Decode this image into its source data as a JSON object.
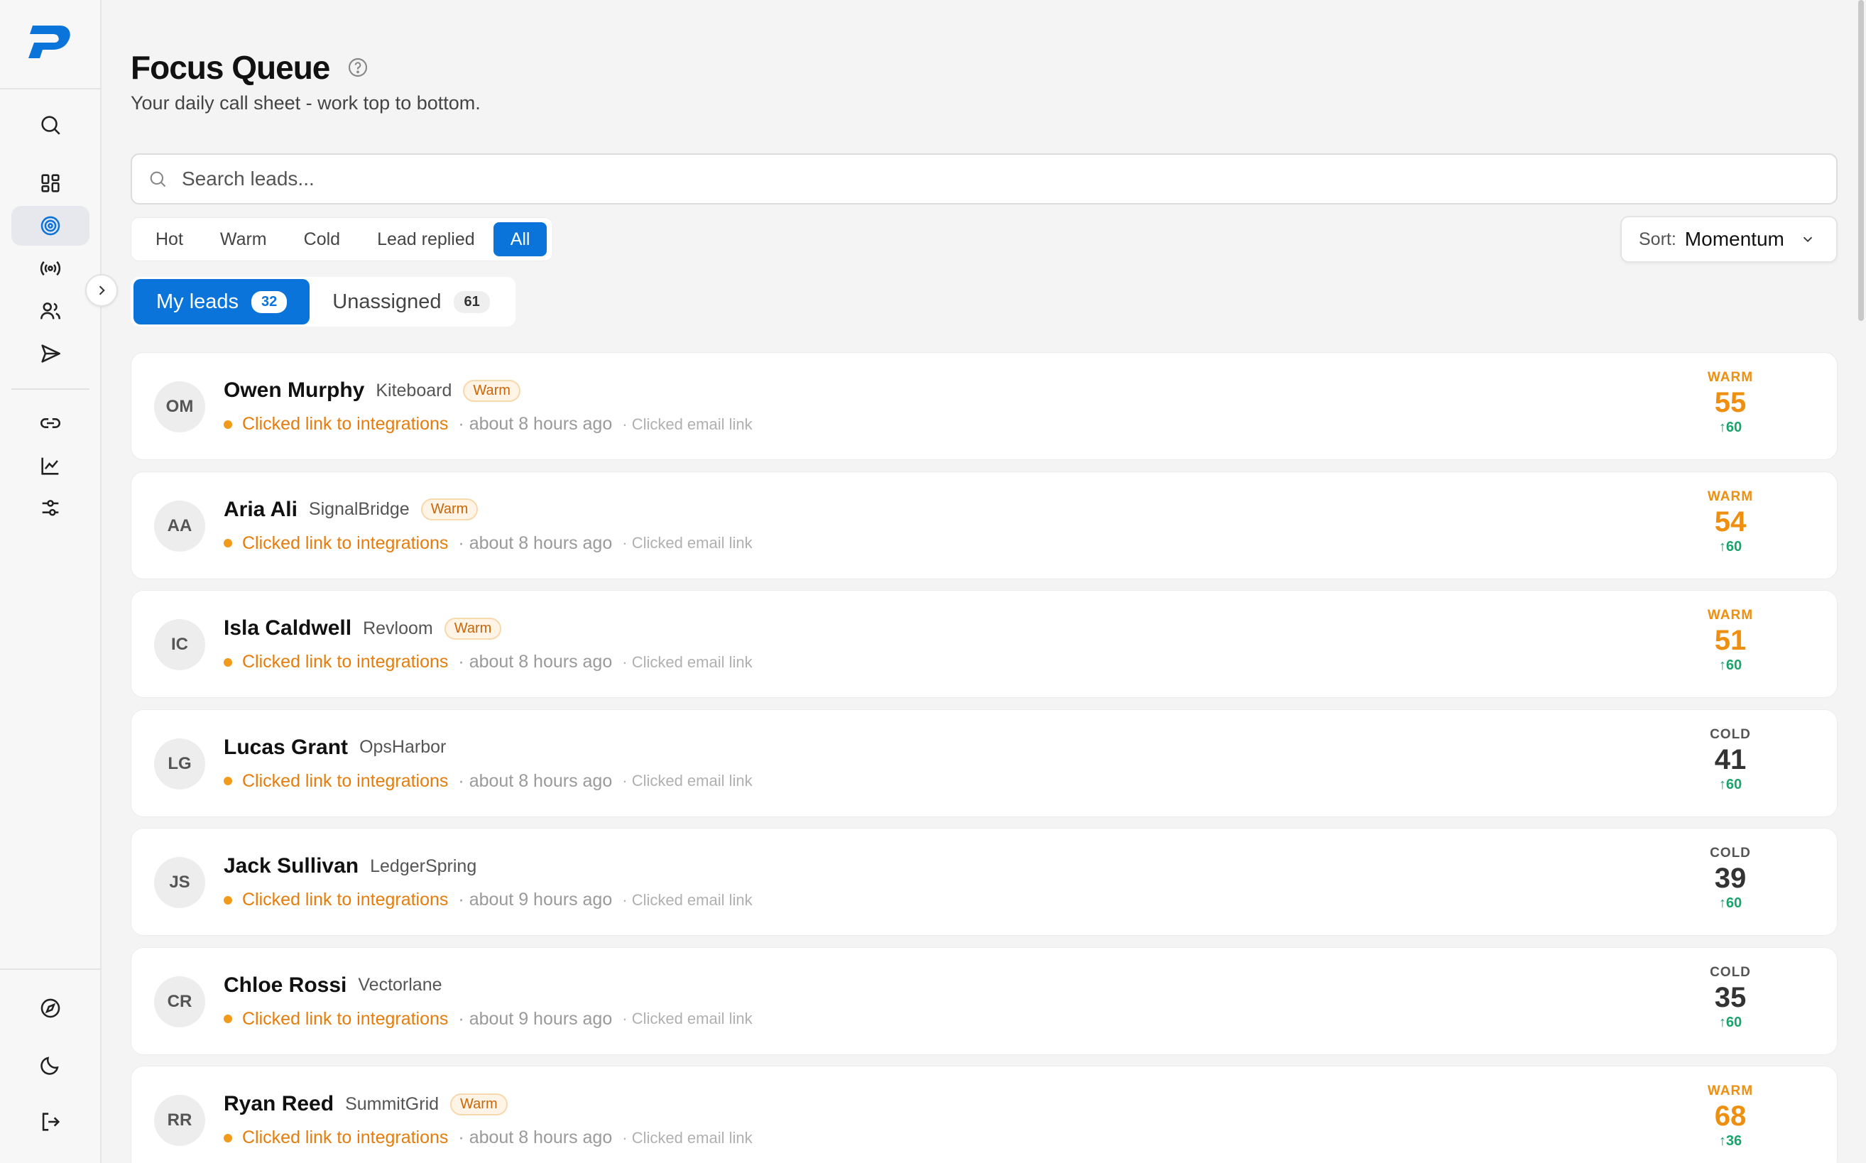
{
  "brand": {
    "logo_icon": "brand-p-logo",
    "accent": "#0a74da"
  },
  "sidebar": {
    "items": [
      {
        "name": "search",
        "icon": "search-icon"
      },
      {
        "name": "dashboard",
        "icon": "dashboard-grid-icon"
      },
      {
        "name": "focus-queue",
        "icon": "target-icon",
        "active": true
      },
      {
        "name": "broadcast",
        "icon": "broadcast-icon"
      },
      {
        "name": "contacts",
        "icon": "users-icon"
      },
      {
        "name": "send",
        "icon": "send-icon"
      },
      {
        "name": "links",
        "icon": "link-icon"
      },
      {
        "name": "analytics",
        "icon": "chart-line-icon"
      },
      {
        "name": "filters",
        "icon": "sliders-icon"
      }
    ],
    "bottom": [
      {
        "name": "explore",
        "icon": "compass-icon"
      },
      {
        "name": "theme",
        "icon": "moon-icon"
      },
      {
        "name": "logout",
        "icon": "logout-icon"
      }
    ]
  },
  "header": {
    "title": "Focus Queue",
    "subtitle": "Your daily call sheet - work top to bottom."
  },
  "search": {
    "placeholder": "Search leads..."
  },
  "filters": {
    "options": [
      "Hot",
      "Warm",
      "Cold",
      "Lead replied",
      "All"
    ],
    "selected": "All"
  },
  "sort": {
    "label": "Sort:",
    "value": "Momentum"
  },
  "tabs": [
    {
      "label": "My leads",
      "count": "32",
      "active": true
    },
    {
      "label": "Unassigned",
      "count": "61",
      "active": false
    }
  ],
  "leads": [
    {
      "initials": "OM",
      "name": "Owen Murphy",
      "company": "Kiteboard",
      "badge": "Warm",
      "activity": "Clicked link to integrations",
      "time": "· about 8 hours ago",
      "source": "· Clicked email link",
      "temp": "WARM",
      "score": "55",
      "delta": "↑60",
      "tone": "warm"
    },
    {
      "initials": "AA",
      "name": "Aria Ali",
      "company": "SignalBridge",
      "badge": "Warm",
      "activity": "Clicked link to integrations",
      "time": "· about 8 hours ago",
      "source": "· Clicked email link",
      "temp": "WARM",
      "score": "54",
      "delta": "↑60",
      "tone": "warm"
    },
    {
      "initials": "IC",
      "name": "Isla Caldwell",
      "company": "Revloom",
      "badge": "Warm",
      "activity": "Clicked link to integrations",
      "time": "· about 8 hours ago",
      "source": "· Clicked email link",
      "temp": "WARM",
      "score": "51",
      "delta": "↑60",
      "tone": "warm"
    },
    {
      "initials": "LG",
      "name": "Lucas Grant",
      "company": "OpsHarbor",
      "badge": "",
      "activity": "Clicked link to integrations",
      "time": "· about 8 hours ago",
      "source": "· Clicked email link",
      "temp": "COLD",
      "score": "41",
      "delta": "↑60",
      "tone": "cold"
    },
    {
      "initials": "JS",
      "name": "Jack Sullivan",
      "company": "LedgerSpring",
      "badge": "",
      "activity": "Clicked link to integrations",
      "time": "· about 9 hours ago",
      "source": "· Clicked email link",
      "temp": "COLD",
      "score": "39",
      "delta": "↑60",
      "tone": "cold"
    },
    {
      "initials": "CR",
      "name": "Chloe Rossi",
      "company": "Vectorlane",
      "badge": "",
      "activity": "Clicked link to integrations",
      "time": "· about 9 hours ago",
      "source": "· Clicked email link",
      "temp": "COLD",
      "score": "35",
      "delta": "↑60",
      "tone": "cold"
    },
    {
      "initials": "RR",
      "name": "Ryan Reed",
      "company": "SummitGrid",
      "badge": "Warm",
      "activity": "Clicked link to integrations",
      "time": "· about 8 hours ago",
      "source": "· Clicked email link",
      "temp": "WARM",
      "score": "68",
      "delta": "↑36",
      "tone": "warm"
    }
  ]
}
